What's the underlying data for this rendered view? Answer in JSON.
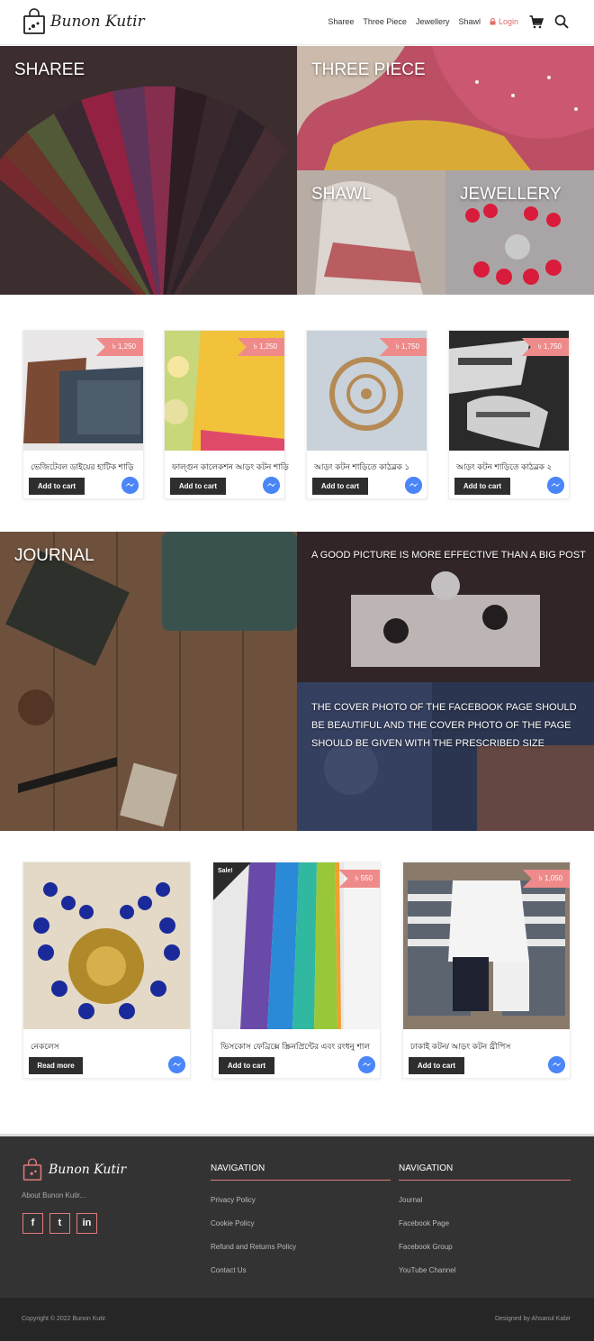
{
  "header": {
    "brand": "Bunon Kutir",
    "nav": [
      "Sharee",
      "Three Piece",
      "Jewellery",
      "Shawl"
    ],
    "login": "Login"
  },
  "categories": {
    "sharee": "SHAREE",
    "three_piece": "THREE PIECE",
    "shawl": "SHAWL",
    "jewellery": "JEWELLERY"
  },
  "products_row1": [
    {
      "price": "৳ 1,250",
      "title": "ভেজিটেবল ডাইয়ের হাটিক শাড়ি",
      "button": "Add to cart"
    },
    {
      "price": "৳ 1,250",
      "title": "ফাল্গুন কালেকশন আড়ং কটন শাড়ি",
      "button": "Add to cart"
    },
    {
      "price": "৳ 1,750",
      "title": "আড়ং কটন শাড়িতে কাঠব্লক ১",
      "button": "Add to cart"
    },
    {
      "price": "৳ 1,750",
      "title": "আড়ং কটন শাড়িতে কাঠব্লক ২",
      "button": "Add to cart"
    }
  ],
  "journal": {
    "title": "JOURNAL",
    "post1": "A GOOD PICTURE IS MORE EFFECTIVE THAN A BIG POST",
    "post2": "THE COVER PHOTO OF THE FACEBOOK PAGE SHOULD BE BEAUTIFUL AND THE COVER PHOTO OF THE PAGE SHOULD BE GIVEN WITH THE PRESCRIBED SIZE"
  },
  "products_row2": [
    {
      "price": "",
      "title": "নেকলেস",
      "button": "Read more",
      "sale": ""
    },
    {
      "price": "৳ 550",
      "title": "ভিসকোস ফেব্রিক্সে স্ক্রিনপ্রিন্টের এবং রংধনু শাল",
      "button": "Add to cart",
      "sale": "Sale!"
    },
    {
      "price": "৳ 1,050",
      "title": "ঢাকাই কটন/ আড়ং কটন থ্রীপিস",
      "button": "Add to cart",
      "sale": ""
    }
  ],
  "footer": {
    "brand": "Bunon Kutir",
    "about": "About Bunon Kutir...",
    "social": [
      "f",
      "t",
      "in"
    ],
    "col1_title": "NAVIGATION",
    "col1_links": [
      "Privacy Policy",
      "Cookie Policy",
      "Refund and Returns Policy",
      "Contact Us"
    ],
    "col2_title": "NAVIGATION",
    "col2_links": [
      "Journal",
      "Facebook Page",
      "Facebook Group",
      "YouTube Channel"
    ],
    "copyright": "Copyright © 2022 Bunon Kutir.",
    "designed_by": "Designed by Ahsanul Kabir"
  },
  "colors": {
    "accent": "#e07b7b",
    "price_ribbon": "#ef8a8a",
    "button": "#2e2e2e",
    "footer": "#333333"
  }
}
